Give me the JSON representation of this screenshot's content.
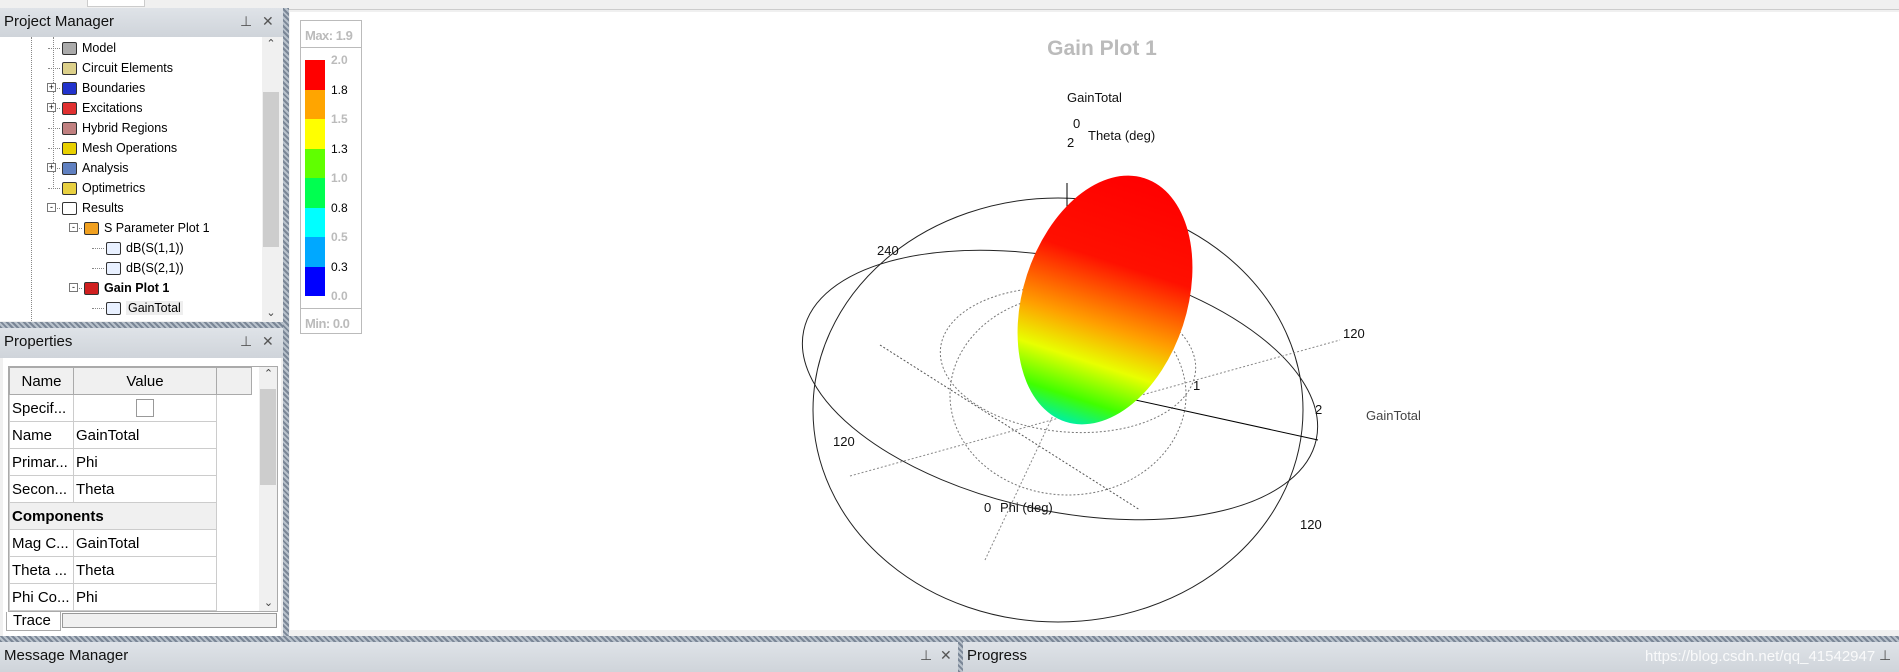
{
  "project_manager": {
    "title": "Project Manager",
    "items": [
      {
        "label": "Model",
        "icon": "model-icon",
        "level": 1,
        "expander": ""
      },
      {
        "label": "Circuit Elements",
        "icon": "circuit-elements-icon",
        "level": 1,
        "expander": ""
      },
      {
        "label": "Boundaries",
        "icon": "boundaries-icon",
        "level": 1,
        "expander": "+"
      },
      {
        "label": "Excitations",
        "icon": "excitations-icon",
        "level": 1,
        "expander": "+"
      },
      {
        "label": "Hybrid Regions",
        "icon": "hybrid-regions-icon",
        "level": 1,
        "expander": ""
      },
      {
        "label": "Mesh Operations",
        "icon": "mesh-operations-icon",
        "level": 1,
        "expander": ""
      },
      {
        "label": "Analysis",
        "icon": "analysis-icon",
        "level": 1,
        "expander": "+"
      },
      {
        "label": "Optimetrics",
        "icon": "optimetrics-icon",
        "level": 1,
        "expander": ""
      },
      {
        "label": "Results",
        "icon": "results-icon",
        "level": 1,
        "expander": "-"
      },
      {
        "label": "S Parameter Plot 1",
        "icon": "s-parameter-plot-icon",
        "level": 2,
        "expander": "-"
      },
      {
        "label": "dB(S(1,1))",
        "icon": "trace-icon",
        "level": 3,
        "expander": ""
      },
      {
        "label": "dB(S(2,1))",
        "icon": "trace-icon",
        "level": 3,
        "expander": ""
      },
      {
        "label": "Gain Plot 1",
        "icon": "gain-plot-icon",
        "level": 2,
        "expander": "-",
        "bold": true
      },
      {
        "label": "GainTotal",
        "icon": "trace-icon",
        "level": 3,
        "expander": "",
        "selected": true
      }
    ]
  },
  "properties": {
    "title": "Properties",
    "columns": [
      "Name",
      "Value"
    ],
    "rows": [
      {
        "name": "Specif...",
        "value": "",
        "checkbox": true
      },
      {
        "name": "Name",
        "value": "GainTotal"
      },
      {
        "name": "Primar...",
        "value": "Phi"
      },
      {
        "name": "Secon...",
        "value": "Theta"
      },
      {
        "name": "Components",
        "value": "",
        "section": true
      },
      {
        "name": "Mag C...",
        "value": "GainTotal"
      },
      {
        "name": "Theta ...",
        "value": "Theta"
      },
      {
        "name": "Phi Co...",
        "value": "Phi"
      }
    ],
    "tab": "Trace"
  },
  "message_manager": {
    "title": "Message Manager"
  },
  "progress": {
    "title": "Progress"
  },
  "watermark": "https://blog.csdn.net/qq_41542947",
  "plot": {
    "title": "Gain Plot 1",
    "quantity": "GainTotal",
    "theta_label": "Theta (deg)",
    "phi_label": "Phi (deg)",
    "theta_zero": "0",
    "phi_zero": "0",
    "radial_ticks": [
      "1",
      "2"
    ],
    "angle_labels": [
      "240",
      "120",
      "120",
      "120"
    ],
    "legend": {
      "max": "Max: 1.9",
      "min": "Min: 0.0",
      "ticks": [
        "2.0",
        "1.8",
        "1.5",
        "1.3",
        "1.0",
        "0.8",
        "0.5",
        "0.3",
        "0.0"
      ],
      "colors": [
        "#ff0000",
        "#ffa500",
        "#ffff00",
        "#60ff00",
        "#00ff50",
        "#00ffff",
        "#00a8ff",
        "#0000ff"
      ]
    }
  }
}
